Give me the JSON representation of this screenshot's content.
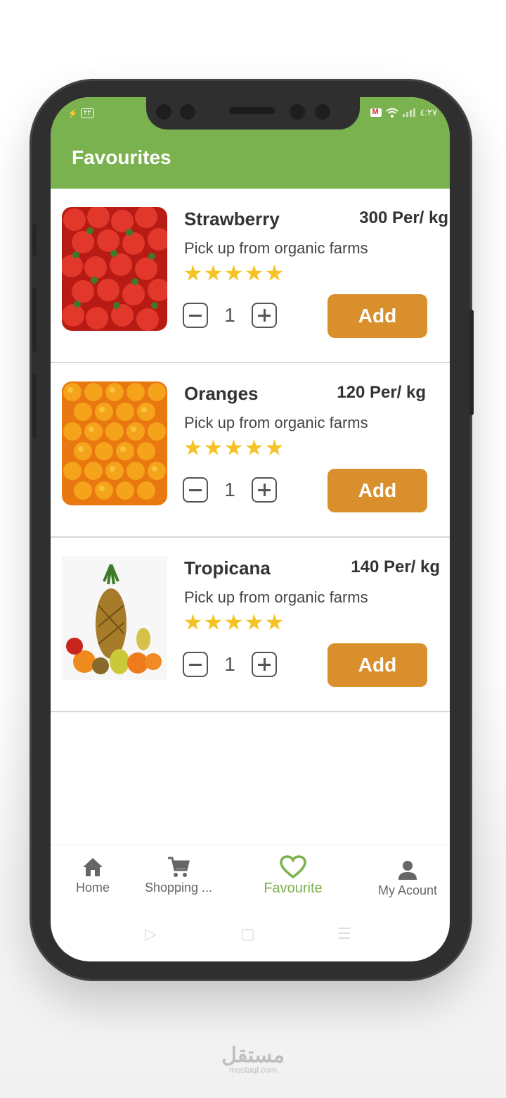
{
  "status_bar": {
    "battery": "٢٢",
    "time": "٤:٢٧"
  },
  "header": {
    "title": "Favourites"
  },
  "products": [
    {
      "name": "Strawberry",
      "price": "300 Per/ kg",
      "description": "Pick up from organic farms",
      "rating": 5,
      "quantity": "1",
      "add_label": "Add",
      "image": "strawberries"
    },
    {
      "name": "Oranges",
      "price": "120 Per/ kg",
      "description": "Pick up from organic farms",
      "rating": 5,
      "quantity": "1",
      "add_label": "Add",
      "image": "oranges"
    },
    {
      "name": "Tropicana",
      "price": "140 Per/ kg",
      "description": "Pick up from organic farms",
      "rating": 5,
      "quantity": "1",
      "add_label": "Add",
      "image": "mixed-fruits-pineapple"
    }
  ],
  "bottom_nav": {
    "items": [
      {
        "label": "Home",
        "icon": "home-icon"
      },
      {
        "label": "Shopping ...",
        "icon": "cart-icon"
      },
      {
        "label": "Favourite",
        "icon": "heart-icon",
        "active": true
      },
      {
        "label": "My Acount",
        "icon": "person-icon"
      }
    ]
  },
  "colors": {
    "primary": "#7ab24f",
    "add_button": "#d98f2b",
    "star": "#f6c324"
  },
  "watermark": {
    "arabic": "مستقل",
    "site": "mostaql.com"
  }
}
